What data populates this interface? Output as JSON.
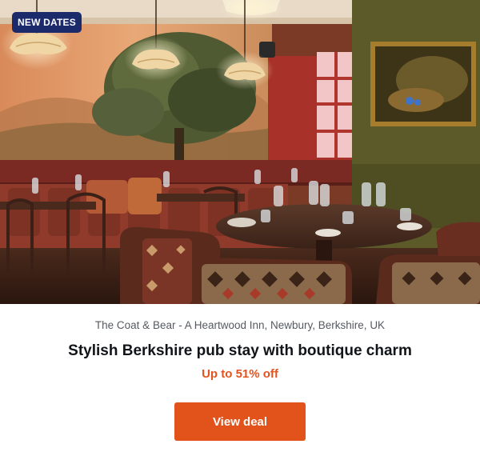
{
  "badge": {
    "label": "NEW DATES"
  },
  "hero": {
    "image_alt": "Restaurant dining room with red banquettes, mural and round tables"
  },
  "deal": {
    "location": "The Coat & Bear - A Heartwood Inn, Newbury, Berkshire, UK",
    "title": "Stylish Berkshire pub stay with boutique charm",
    "discount": "Up to 51% off",
    "cta_label": "View deal"
  },
  "colors": {
    "badge_bg": "#1b2a6b",
    "accent": "#e2531b",
    "title": "#111418",
    "subtext": "#555a60"
  }
}
